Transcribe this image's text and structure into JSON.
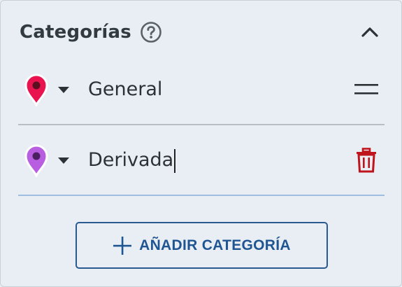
{
  "header": {
    "title": "Categorías",
    "help_icon": "question-circle-icon",
    "collapse_icon": "chevron-up-icon"
  },
  "categories": [
    {
      "name": "General",
      "pin_color": "#e8134f",
      "pin_icon": "map-pin-icon",
      "dropdown_icon": "caret-down-icon",
      "action_icon": "drag-handle-icon"
    },
    {
      "name": "Derivada",
      "pin_color": "#b85ee0",
      "pin_icon": "map-pin-icon",
      "dropdown_icon": "caret-down-icon",
      "action_icon": "trash-icon"
    }
  ],
  "add_button": {
    "label": "AÑADIR CATEGORÍA",
    "icon": "plus-icon"
  },
  "colors": {
    "background": "#e8eef3",
    "title": "#333b42",
    "accent": "#1f5592",
    "delete": "#c0141d"
  }
}
